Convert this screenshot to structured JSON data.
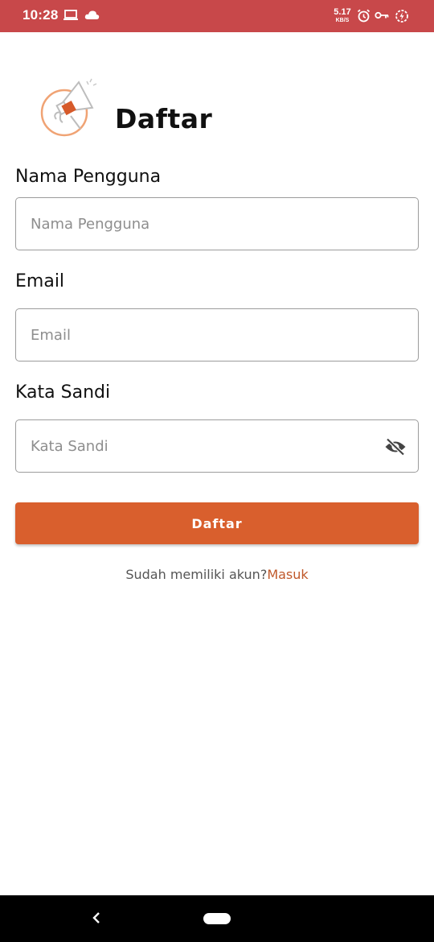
{
  "status_bar": {
    "time": "10:28",
    "net_speed_value": "5.17",
    "net_speed_unit": "KB/S",
    "background_color": "#c8484a",
    "icons": [
      "laptop-icon",
      "cloud-icon",
      "alarm-icon",
      "key-icon",
      "battery-saver-icon"
    ]
  },
  "header": {
    "title": "Daftar"
  },
  "form": {
    "username": {
      "label": "Nama Pengguna",
      "placeholder": "Nama Pengguna",
      "value": ""
    },
    "email": {
      "label": "Email",
      "placeholder": "Email",
      "value": ""
    },
    "password": {
      "label": "Kata Sandi",
      "placeholder": "Kata Sandi",
      "value": "",
      "toggle_icon": "eye-off-icon"
    },
    "submit_label": "Daftar",
    "accent_color": "#d95f2d"
  },
  "footer": {
    "prompt_text": "Sudah memiliki akun?",
    "login_link": "Masuk"
  },
  "nav_bar": {
    "icons": [
      "back-icon",
      "home-pill-icon"
    ]
  }
}
